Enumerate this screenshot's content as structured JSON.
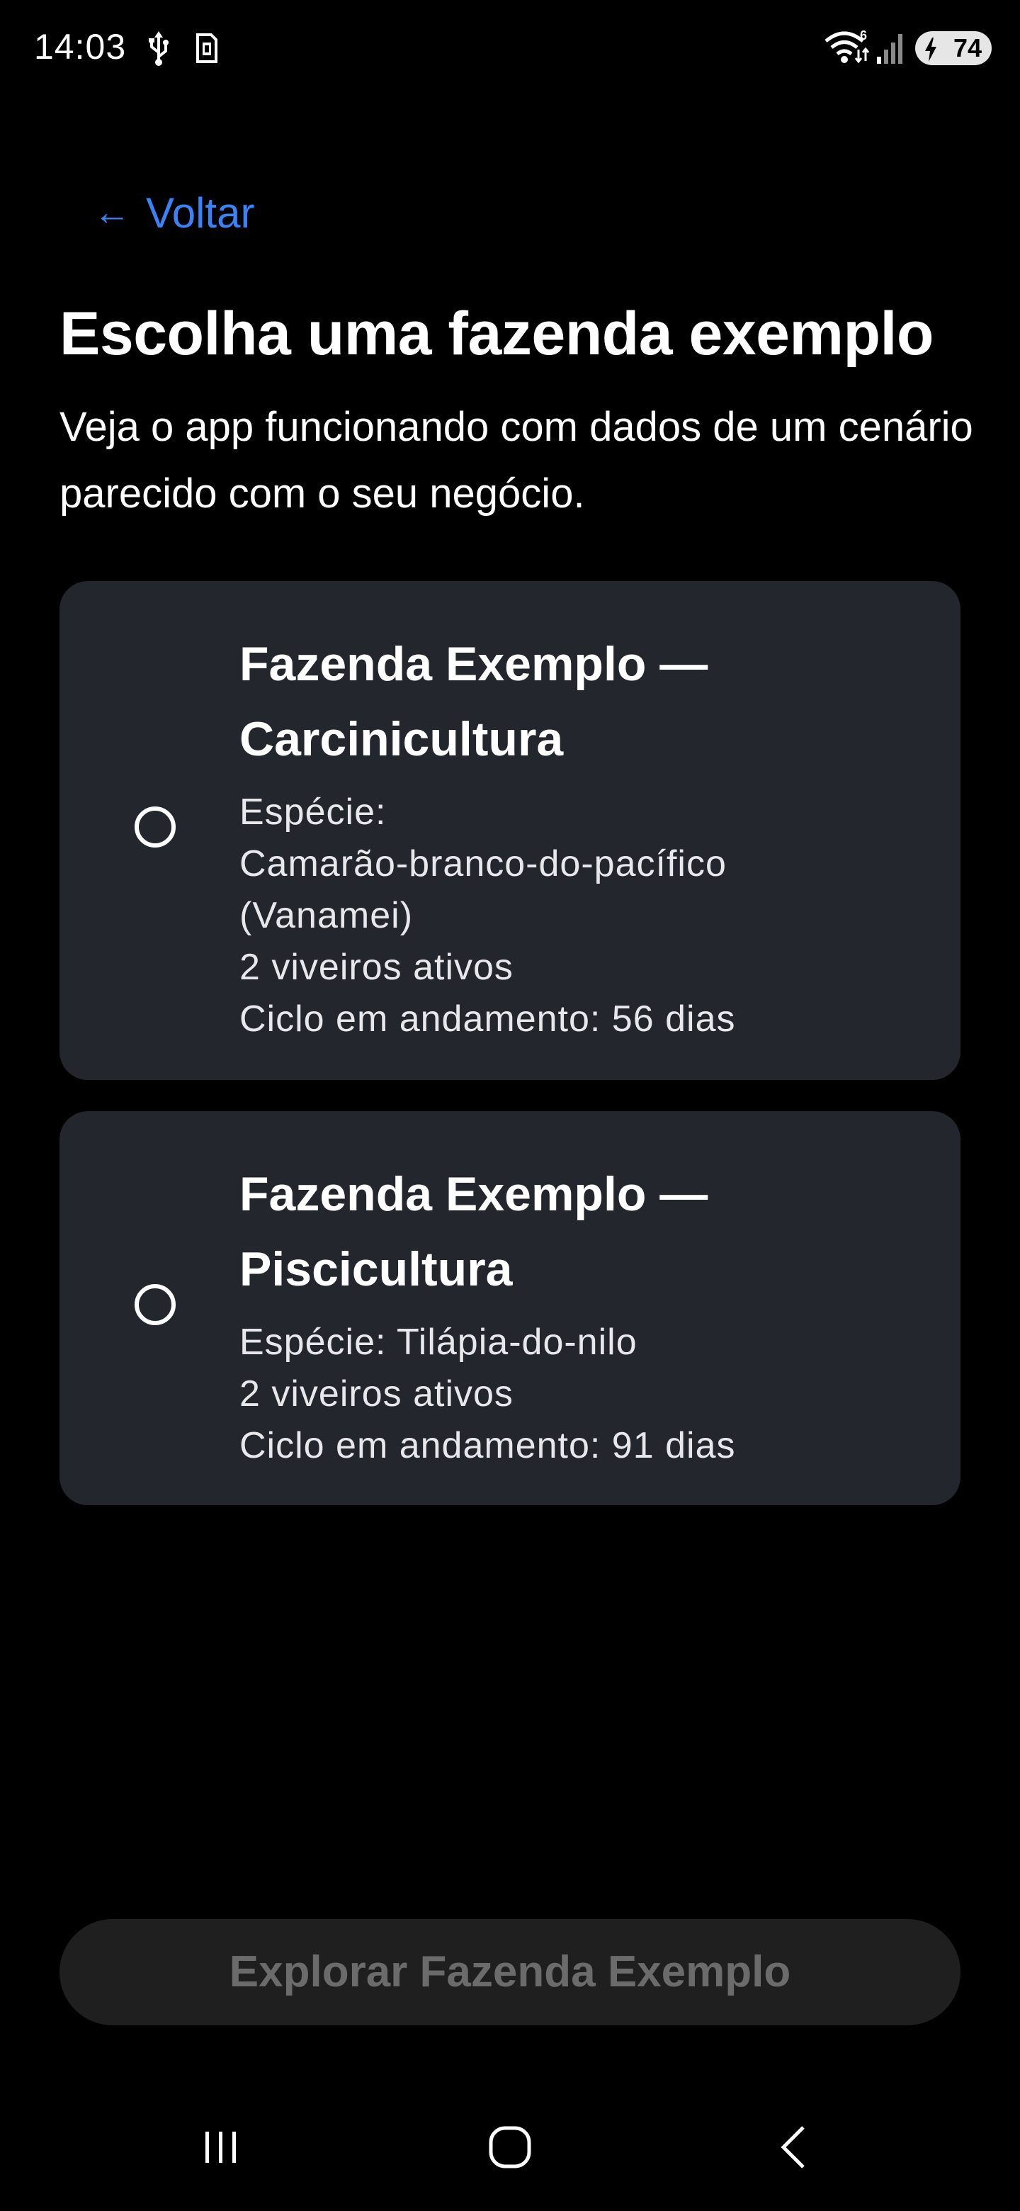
{
  "status_bar": {
    "time": "14:03",
    "battery_level": "74",
    "icons": [
      "usb-icon",
      "sim-card-icon",
      "wifi-icon",
      "signal-icon",
      "battery-charging-icon"
    ]
  },
  "back": {
    "arrow": "←",
    "label": "Voltar"
  },
  "header": {
    "title": "Escolha uma fazenda exemplo",
    "subtitle": "Veja o app funcionando com dados de um cenário parecido com o seu negócio."
  },
  "options": [
    {
      "title_line1": "Fazenda Exemplo —",
      "title_line2": "Carcinicultura",
      "species_label": "Espécie:",
      "species_line1": "Camarão-branco-do-pacífico",
      "species_line2": "(Vanamei)",
      "ponds": "2 viveiros ativos",
      "cycle": "Ciclo em andamento: 56 dias",
      "selected": false
    },
    {
      "title_line1": "Fazenda Exemplo —",
      "title_line2": "Piscicultura",
      "species": "Espécie: Tilápia-do-nilo",
      "ponds": "2 viveiros ativos",
      "cycle": "Ciclo em andamento: 91 dias",
      "selected": false
    }
  ],
  "primary_action": {
    "label": "Explorar Fazenda Exemplo",
    "enabled": false
  },
  "nav_bar": {
    "icons": [
      "recents-icon",
      "home-icon",
      "back-icon"
    ]
  },
  "colors": {
    "background": "#000000",
    "card": "#24262e",
    "accent": "#3b82f6",
    "button_disabled_bg": "#1f1f1f",
    "button_disabled_text": "#6b6b6b"
  }
}
